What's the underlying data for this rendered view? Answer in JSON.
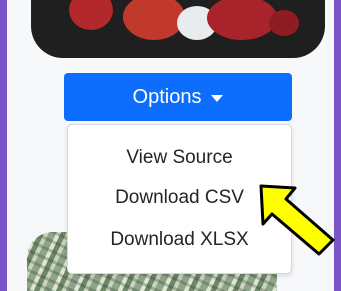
{
  "options_button": {
    "label": "Options",
    "caret_icon": "caret-down-icon"
  },
  "dropdown": {
    "items": [
      {
        "label": "View Source"
      },
      {
        "label": "Download CSV"
      },
      {
        "label": "Download XLSX"
      }
    ]
  },
  "annotation": {
    "icon": "arrow-pointer-icon",
    "color": "#ffff00"
  },
  "colors": {
    "page_background": "#7b55c7",
    "panel_background": "#f7f8fa",
    "button_primary": "#0d6efd",
    "virus_red": "#c0392b"
  }
}
